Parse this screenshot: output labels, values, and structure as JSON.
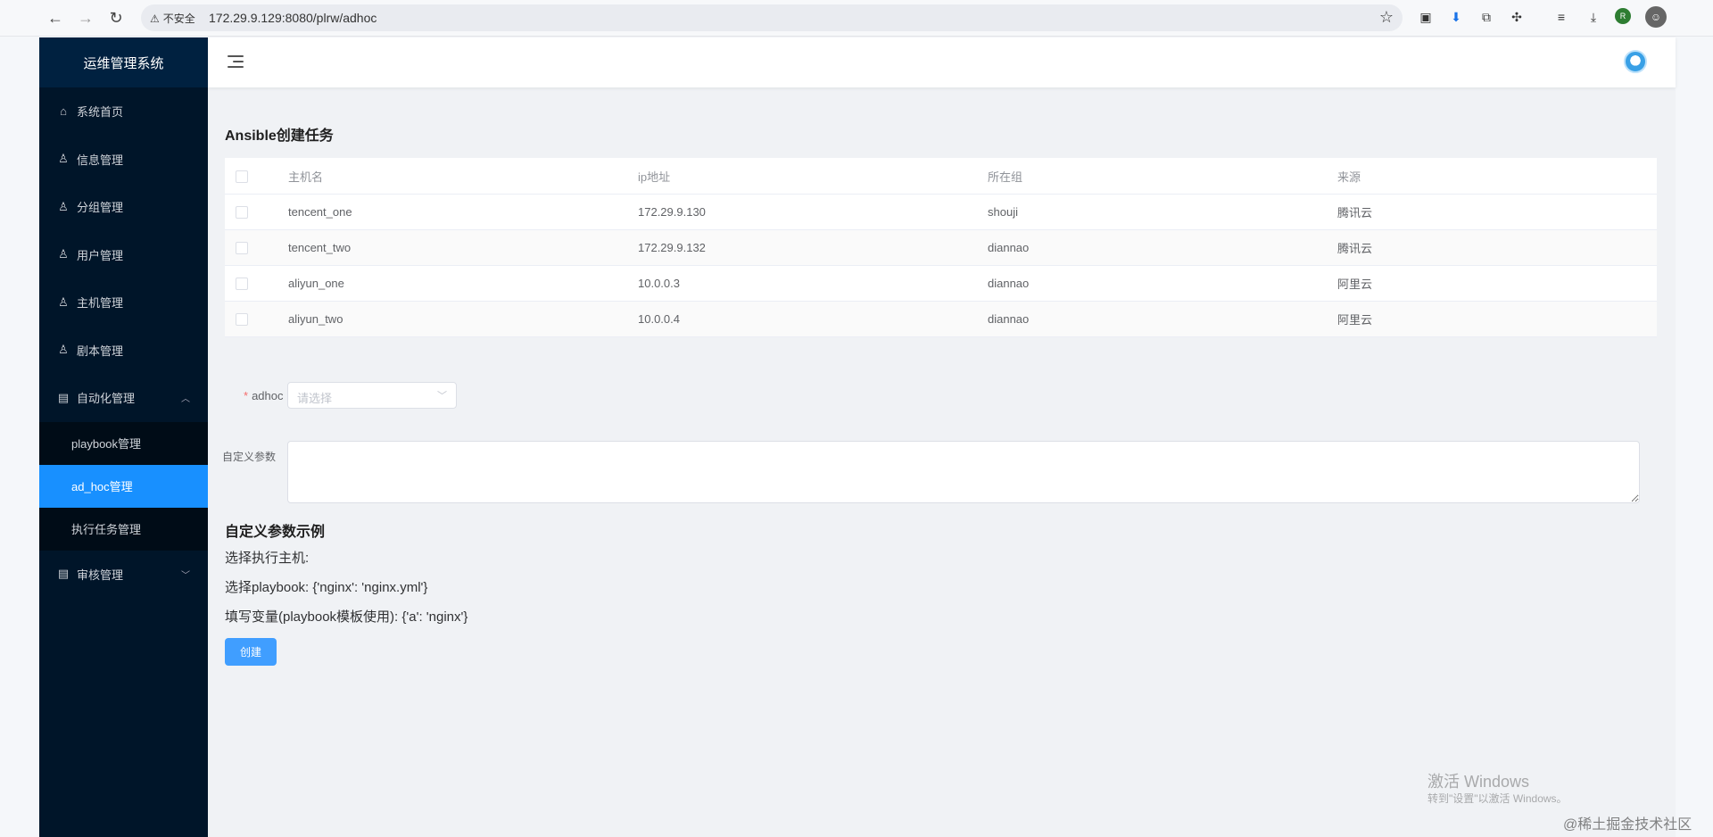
{
  "browser": {
    "back": "←",
    "forward": "→",
    "reload": "↻",
    "security": "不安全",
    "url": "172.29.9.129:8080/plrw/adhoc"
  },
  "app": {
    "title": "运维管理系统"
  },
  "sidebar": {
    "items": [
      {
        "label": "系统首页",
        "icon": "home-icon"
      },
      {
        "label": "信息管理",
        "icon": "user-icon"
      },
      {
        "label": "分组管理",
        "icon": "user-icon"
      },
      {
        "label": "用户管理",
        "icon": "user-icon"
      },
      {
        "label": "主机管理",
        "icon": "user-icon"
      },
      {
        "label": "剧本管理",
        "icon": "user-icon"
      },
      {
        "label": "自动化管理",
        "icon": "document-icon",
        "expanded": true
      },
      {
        "label": "审核管理",
        "icon": "document-icon",
        "expanded": false
      }
    ],
    "submenu": [
      {
        "label": "playbook管理",
        "active": false
      },
      {
        "label": "ad_hoc管理",
        "active": true
      },
      {
        "label": "执行任务管理",
        "active": false
      }
    ]
  },
  "page": {
    "title": "Ansible创建任务",
    "table": {
      "headers": [
        "主机名",
        "ip地址",
        "所在组",
        "来源"
      ],
      "rows": [
        [
          "tencent_one",
          "172.29.9.130",
          "shouji",
          "腾讯云"
        ],
        [
          "tencent_two",
          "172.29.9.132",
          "diannao",
          "腾讯云"
        ],
        [
          "aliyun_one",
          "10.0.0.3",
          "diannao",
          "阿里云"
        ],
        [
          "aliyun_two",
          "10.0.0.4",
          "diannao",
          "阿里云"
        ]
      ]
    },
    "form": {
      "adhoc_label": "adhoc",
      "adhoc_required_mark": "*",
      "adhoc_placeholder": "请选择",
      "param_label": "自定义参数",
      "param_value": ""
    },
    "example": {
      "title": "自定义参数示例",
      "lines": [
        "选择执行主机:",
        "选择playbook: {'nginx': 'nginx.yml'}",
        "填写变量(playbook模板使用): {'a': 'nginx'}"
      ]
    },
    "create_button": "创建"
  },
  "watermark": {
    "activate_title": "激活 Windows",
    "activate_sub": "转到\"设置\"以激活 Windows。",
    "community": "@稀土掘金技术社区"
  },
  "colors": {
    "sidebar_bg": "#001529",
    "active_menu": "#1890ff",
    "primary_button": "#409eff"
  }
}
